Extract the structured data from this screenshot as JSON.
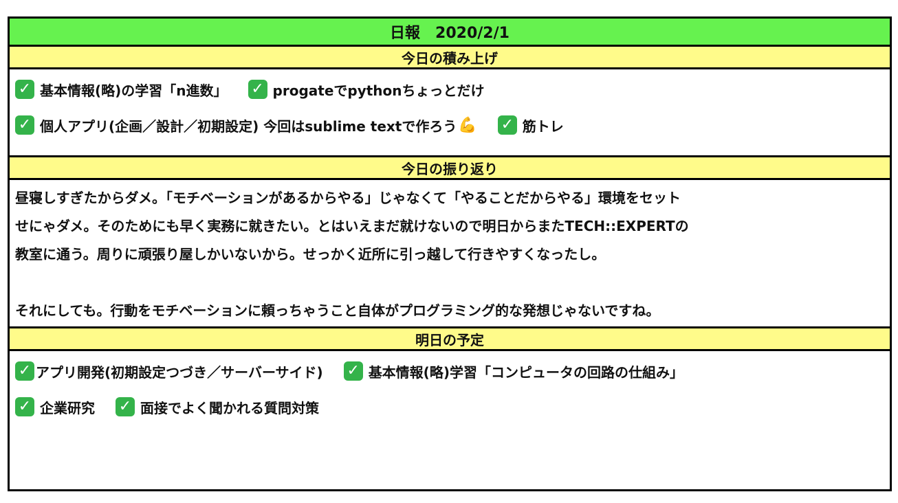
{
  "title": "日報　2020/2/1",
  "today_done": {
    "header": "今日の積み上げ",
    "lines": [
      [
        "基本情報(略)の学習「n進数」",
        "progateでpythonちょっとだけ"
      ],
      [
        "個人アプリ(企画／設計／初期設定) 今回はsublime textで作ろう",
        "筋トレ"
      ]
    ]
  },
  "reflection": {
    "header": "今日の振り返り",
    "lines": [
      "昼寝しすぎたからダメ。「モチベーションがあるからやる」じゃなくて「やることだからやる」環境をセット",
      "せにゃダメ。そのためにも早く実務に就きたい。とはいえまだ就けないので明日からまたTECH::EXPERTの",
      "教室に通う。周りに頑張り屋しかいないから。せっかく近所に引っ越して行きやすくなったし。",
      "",
      "それにしても。行動をモチベーションに頼っちゃうこと自体がプログラミング的な発想じゃないですね。"
    ]
  },
  "tomorrow": {
    "header": "明日の予定",
    "lines": [
      [
        "アプリ開発(初期設定つづき／サーバーサイド)",
        "基本情報(略)学習「コンピュータの回路の仕組み」"
      ],
      [
        "企業研究",
        "面接でよく聞かれる質問対策"
      ]
    ]
  },
  "icons": {
    "check": "check-mark-button-icon",
    "muscle": "flexed-biceps-icon"
  },
  "colors": {
    "title_bg": "#66f24f",
    "header_bg": "#fffb8a",
    "check_bg": "#34b34a",
    "border": "#000000"
  }
}
